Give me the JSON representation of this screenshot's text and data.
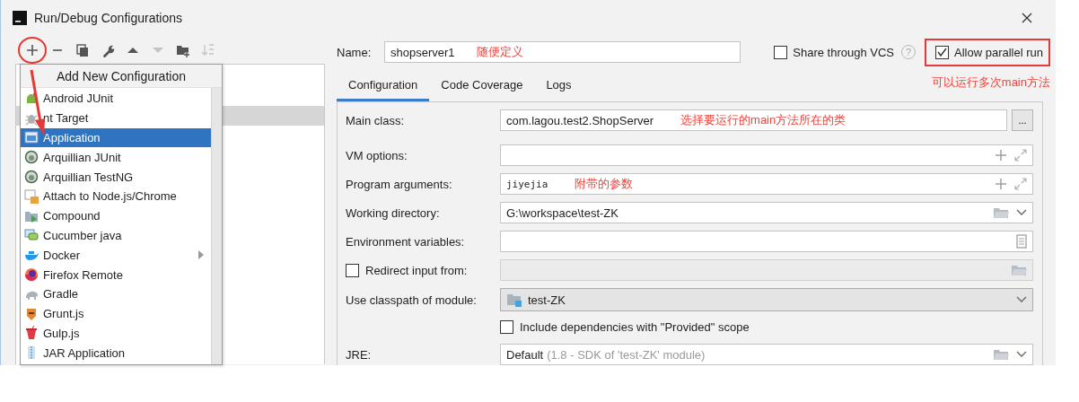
{
  "window": {
    "title": "Run/Debug Configurations"
  },
  "toolbar": [
    {
      "kind": "add",
      "disabled": false
    },
    {
      "kind": "remove",
      "disabled": false
    },
    {
      "kind": "copy",
      "disabled": false
    },
    {
      "kind": "edit",
      "disabled": false
    },
    {
      "kind": "up",
      "disabled": false
    },
    {
      "kind": "down",
      "disabled": true
    },
    {
      "kind": "folder",
      "disabled": false
    },
    {
      "kind": "sort",
      "disabled": true
    }
  ],
  "tree": {
    "rows": [
      {
        "selected": false
      },
      {
        "selected": false
      },
      {
        "selected": true
      }
    ]
  },
  "add_menu": {
    "title": "Add New Configuration",
    "items": [
      {
        "kind": "android",
        "label": "Android JUnit",
        "selected": false,
        "submenu": false
      },
      {
        "kind": "ant",
        "label": "nt Target",
        "selected": false,
        "submenu": false
      },
      {
        "kind": "application",
        "label": "Application",
        "selected": true,
        "submenu": false
      },
      {
        "kind": "arquillian",
        "label": "Arquillian JUnit",
        "selected": false,
        "submenu": false
      },
      {
        "kind": "arquillian",
        "label": "Arquillian TestNG",
        "selected": false,
        "submenu": false
      },
      {
        "kind": "node",
        "label": "Attach to Node.js/Chrome",
        "selected": false,
        "submenu": false
      },
      {
        "kind": "compound",
        "label": "Compound",
        "selected": false,
        "submenu": false
      },
      {
        "kind": "cucumber",
        "label": "Cucumber java",
        "selected": false,
        "submenu": false
      },
      {
        "kind": "docker",
        "label": "Docker",
        "selected": false,
        "submenu": true
      },
      {
        "kind": "firefox",
        "label": "Firefox Remote",
        "selected": false,
        "submenu": false
      },
      {
        "kind": "gradle",
        "label": "Gradle",
        "selected": false,
        "submenu": false
      },
      {
        "kind": "grunt",
        "label": "Grunt.js",
        "selected": false,
        "submenu": false
      },
      {
        "kind": "gulp",
        "label": "Gulp.js",
        "selected": false,
        "submenu": false
      },
      {
        "kind": "jar",
        "label": "JAR Application",
        "selected": false,
        "submenu": false
      }
    ]
  },
  "name": {
    "label": "Name:",
    "value": "shopserver1",
    "note": "随便定义"
  },
  "share": {
    "label": "Share through VCS",
    "checked": false,
    "help": "?"
  },
  "parallel": {
    "label": "Allow parallel run",
    "checked": true,
    "note": "可以运行多次main方法"
  },
  "tabs": [
    {
      "label": "Configuration",
      "selected": true
    },
    {
      "label": "Code Coverage",
      "selected": false
    },
    {
      "label": "Logs",
      "selected": false
    }
  ],
  "form": [
    {
      "kind": "class",
      "label": "Main class:",
      "value": "com.lagou.test2.ShopServer",
      "note": "选择要运行的main方法所在的类",
      "button": "..."
    },
    {
      "kind": "expand",
      "label": "VM options:"
    },
    {
      "kind": "expand",
      "label": "Program arguments:",
      "value": "jiyejia",
      "note": "附带的参数"
    },
    {
      "kind": "dir",
      "label": "Working directory:",
      "value": "G:\\workspace\\test-ZK"
    },
    {
      "kind": "env",
      "label": "Environment variables:"
    },
    {
      "kind": "redirect",
      "label": "Redirect input from:",
      "checked": false,
      "disabled": true
    },
    {
      "kind": "module",
      "label": "Use classpath of module:",
      "value": "test-ZK"
    },
    {
      "kind": "check",
      "label": "Include dependencies with \"Provided\" scope",
      "checked": false
    },
    {
      "kind": "jre",
      "label": "JRE:",
      "value": "Default",
      "detail": "(1.8 - SDK of 'test-ZK' module)"
    }
  ]
}
